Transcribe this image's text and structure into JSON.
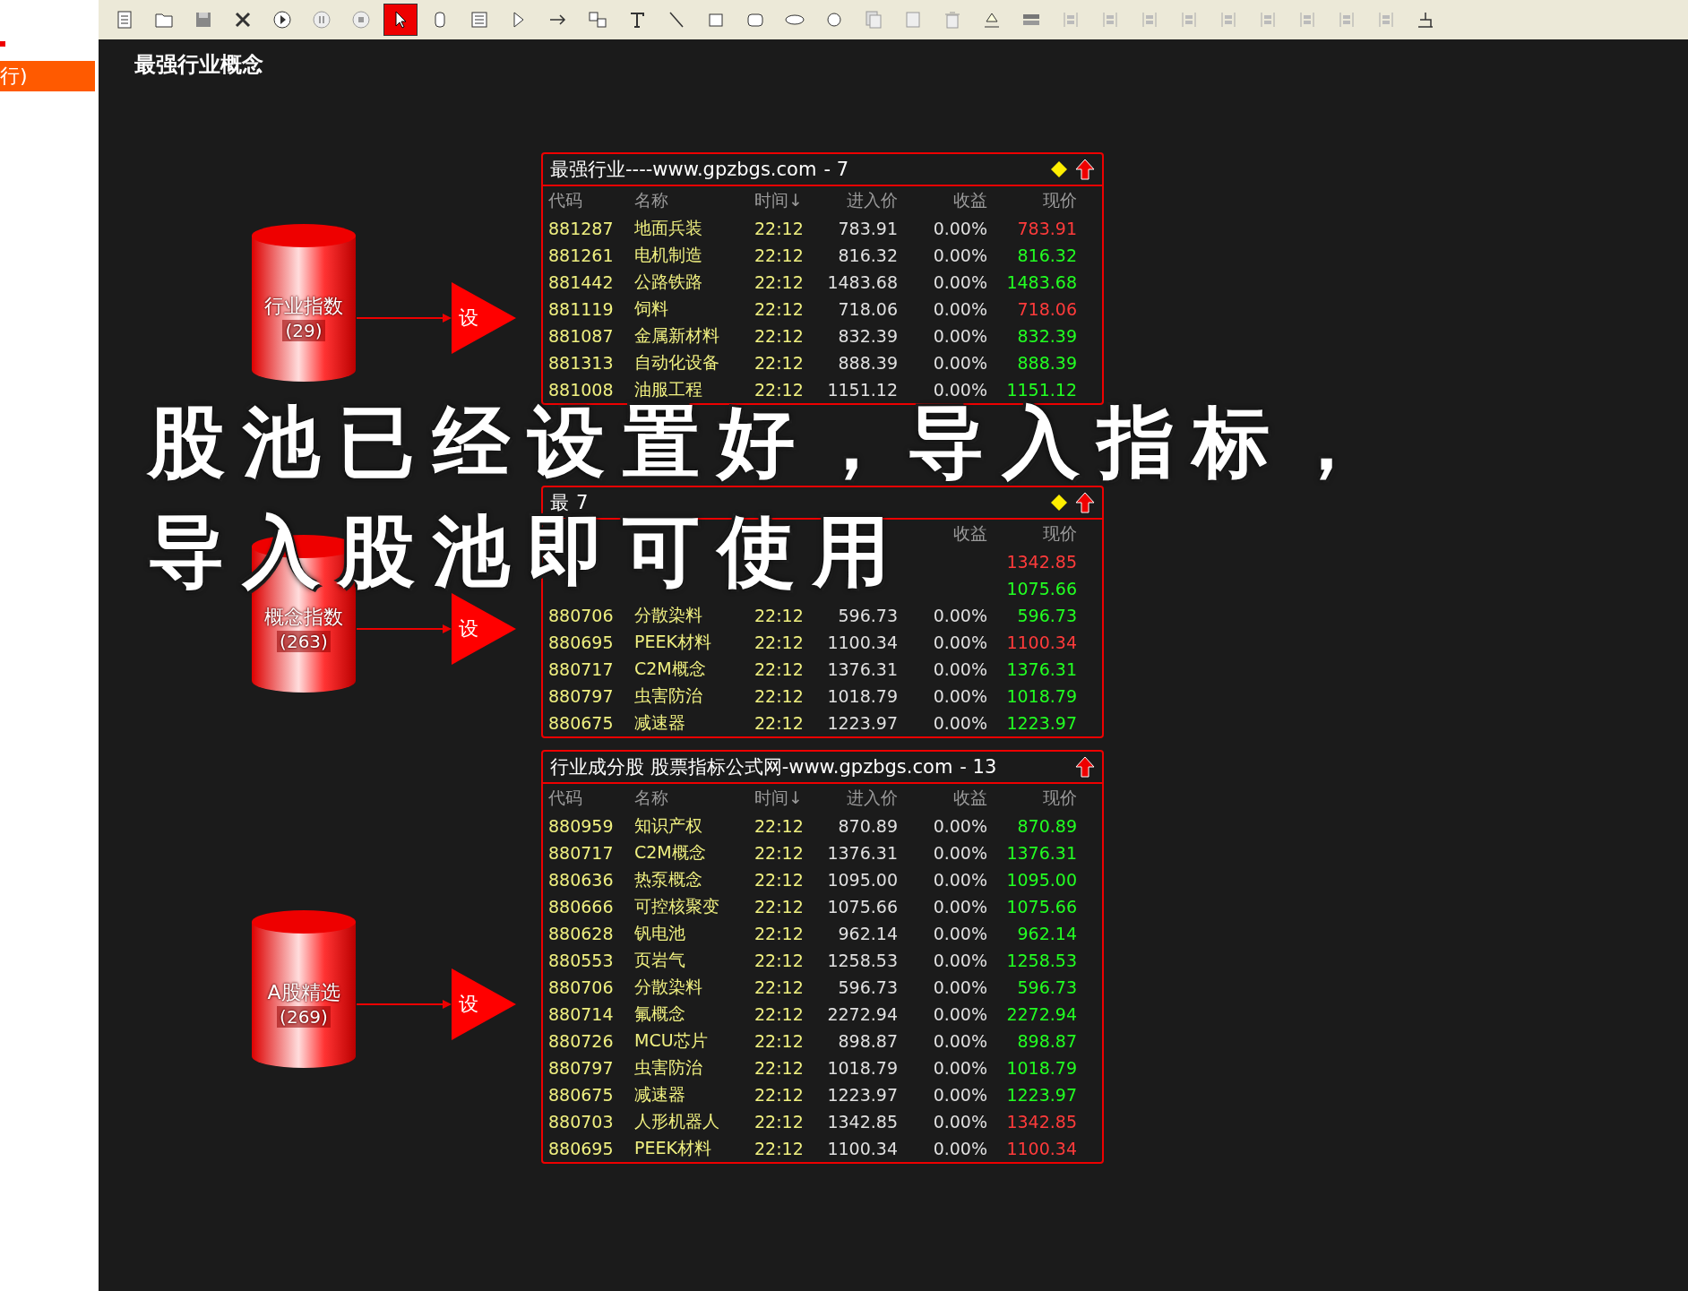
{
  "toolbar": {
    "tools": [
      {
        "selected": false
      },
      {
        "selected": false
      },
      {
        "selected": false
      },
      {
        "selected": false
      },
      {
        "selected": false
      },
      {
        "selected": false
      },
      {
        "selected": false
      },
      {
        "selected": true
      },
      {
        "selected": false
      },
      {
        "selected": false
      },
      {
        "selected": false
      },
      {
        "selected": false
      },
      {
        "selected": false
      },
      {
        "selected": false
      },
      {
        "selected": false
      },
      {
        "selected": false
      },
      {
        "selected": false
      },
      {
        "selected": false
      },
      {
        "selected": false
      },
      {
        "selected": false
      },
      {
        "selected": false
      },
      {
        "selected": false
      },
      {
        "selected": false
      },
      {
        "selected": false
      },
      {
        "selected": false
      },
      {
        "selected": false
      },
      {
        "selected": false
      },
      {
        "selected": false
      },
      {
        "selected": false
      },
      {
        "selected": false
      },
      {
        "selected": false
      },
      {
        "selected": false
      },
      {
        "selected": false
      },
      {
        "selected": false
      }
    ]
  },
  "left_strip": {
    "item": "行)"
  },
  "page_title": "最强行业概念",
  "sources": [
    {
      "label": "行业指数",
      "count": "(29)",
      "button": "设"
    },
    {
      "label": "概念指数",
      "count": "(263)",
      "button": "设"
    },
    {
      "label": "A股精选",
      "count": "(269)",
      "button": "设"
    }
  ],
  "panels": [
    {
      "title": "最强行业----www.gpzbgs.com",
      "count": "- 7",
      "diamond": true,
      "columns": [
        "代码",
        "名称",
        "时间↓",
        "进入价",
        "收益",
        "现价"
      ],
      "rows": [
        {
          "code": "881287",
          "name": "地面兵装",
          "time": "22:12",
          "entry": "783.91",
          "change": "0.00%",
          "price": "783.91",
          "up": false
        },
        {
          "code": "881261",
          "name": "电机制造",
          "time": "22:12",
          "entry": "816.32",
          "change": "0.00%",
          "price": "816.32",
          "up": true
        },
        {
          "code": "881442",
          "name": "公路铁路",
          "time": "22:12",
          "entry": "1483.68",
          "change": "0.00%",
          "price": "1483.68",
          "up": true
        },
        {
          "code": "881119",
          "name": "饲料",
          "time": "22:12",
          "entry": "718.06",
          "change": "0.00%",
          "price": "718.06",
          "up": false
        },
        {
          "code": "881087",
          "name": "金属新材料",
          "time": "22:12",
          "entry": "832.39",
          "change": "0.00%",
          "price": "832.39",
          "up": true
        },
        {
          "code": "881313",
          "name": "自动化设备",
          "time": "22:12",
          "entry": "888.39",
          "change": "0.00%",
          "price": "888.39",
          "up": true
        },
        {
          "code": "881008",
          "name": "油服工程",
          "time": "22:12",
          "entry": "1151.12",
          "change": "0.00%",
          "price": "1151.12",
          "up": true
        }
      ]
    },
    {
      "title": "最",
      "count": "7",
      "diamond": true,
      "columns": [
        "收益",
        "现价"
      ],
      "rows": [
        {
          "price": "1342.85",
          "up": false
        },
        {
          "price": "1075.66",
          "up": true
        },
        {
          "code": "880706",
          "name": "分散染料",
          "time": "22:12",
          "entry": "596.73",
          "change": "0.00%",
          "price": "596.73",
          "up": true
        },
        {
          "code": "880695",
          "name": "PEEK材料",
          "time": "22:12",
          "entry": "1100.34",
          "change": "0.00%",
          "price": "1100.34",
          "up": false
        },
        {
          "code": "880717",
          "name": "C2M概念",
          "time": "22:12",
          "entry": "1376.31",
          "change": "0.00%",
          "price": "1376.31",
          "up": true
        },
        {
          "code": "880797",
          "name": "虫害防治",
          "time": "22:12",
          "entry": "1018.79",
          "change": "0.00%",
          "price": "1018.79",
          "up": true
        },
        {
          "code": "880675",
          "name": "减速器",
          "time": "22:12",
          "entry": "1223.97",
          "change": "0.00%",
          "price": "1223.97",
          "up": true
        }
      ]
    },
    {
      "title": "行业成分股 股票指标公式网-www.gpzbgs.com",
      "count": "- 13",
      "diamond": false,
      "columns": [
        "代码",
        "名称",
        "时间↓",
        "进入价",
        "收益",
        "现价"
      ],
      "rows": [
        {
          "code": "880959",
          "name": "知识产权",
          "time": "22:12",
          "entry": "870.89",
          "change": "0.00%",
          "price": "870.89",
          "up": true
        },
        {
          "code": "880717",
          "name": "C2M概念",
          "time": "22:12",
          "entry": "1376.31",
          "change": "0.00%",
          "price": "1376.31",
          "up": true
        },
        {
          "code": "880636",
          "name": "热泵概念",
          "time": "22:12",
          "entry": "1095.00",
          "change": "0.00%",
          "price": "1095.00",
          "up": true
        },
        {
          "code": "880666",
          "name": "可控核聚变",
          "time": "22:12",
          "entry": "1075.66",
          "change": "0.00%",
          "price": "1075.66",
          "up": true
        },
        {
          "code": "880628",
          "name": "钒电池",
          "time": "22:12",
          "entry": "962.14",
          "change": "0.00%",
          "price": "962.14",
          "up": true
        },
        {
          "code": "880553",
          "name": "页岩气",
          "time": "22:12",
          "entry": "1258.53",
          "change": "0.00%",
          "price": "1258.53",
          "up": true
        },
        {
          "code": "880706",
          "name": "分散染料",
          "time": "22:12",
          "entry": "596.73",
          "change": "0.00%",
          "price": "596.73",
          "up": true
        },
        {
          "code": "880714",
          "name": "氟概念",
          "time": "22:12",
          "entry": "2272.94",
          "change": "0.00%",
          "price": "2272.94",
          "up": true
        },
        {
          "code": "880726",
          "name": "MCU芯片",
          "time": "22:12",
          "entry": "898.87",
          "change": "0.00%",
          "price": "898.87",
          "up": true
        },
        {
          "code": "880797",
          "name": "虫害防治",
          "time": "22:12",
          "entry": "1018.79",
          "change": "0.00%",
          "price": "1018.79",
          "up": true
        },
        {
          "code": "880675",
          "name": "减速器",
          "time": "22:12",
          "entry": "1223.97",
          "change": "0.00%",
          "price": "1223.97",
          "up": true
        },
        {
          "code": "880703",
          "name": "人形机器人",
          "time": "22:12",
          "entry": "1342.85",
          "change": "0.00%",
          "price": "1342.85",
          "up": false
        },
        {
          "code": "880695",
          "name": "PEEK材料",
          "time": "22:12",
          "entry": "1100.34",
          "change": "0.00%",
          "price": "1100.34",
          "up": false
        }
      ]
    }
  ],
  "caption": [
    "股池已经设置好，导入指标，",
    "导入股池即可使用"
  ]
}
